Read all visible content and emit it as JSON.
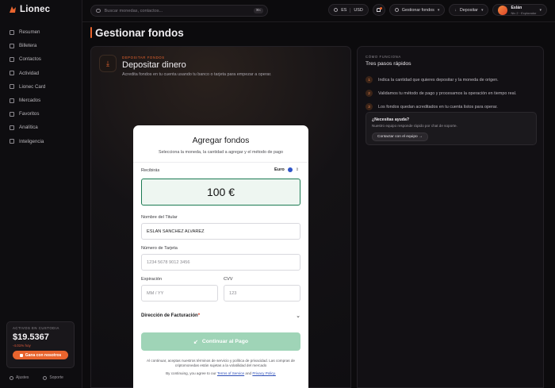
{
  "brand": {
    "name": "Lionec",
    "accent": "#e8642e",
    "success": "#1b7a52"
  },
  "sidebar": {
    "items": [
      {
        "label": "Resumen",
        "icon": "grid-icon"
      },
      {
        "label": "Billetera",
        "icon": "wallet-icon"
      },
      {
        "label": "Contactos",
        "icon": "contacts-icon"
      },
      {
        "label": "Actividad",
        "icon": "activity-icon"
      },
      {
        "label": "Lionec Card",
        "icon": "card-icon"
      },
      {
        "label": "Mercados",
        "icon": "markets-icon"
      },
      {
        "label": "Favoritos",
        "icon": "star-icon"
      },
      {
        "label": "Analítica",
        "icon": "chart-icon"
      },
      {
        "label": "Inteligencia",
        "icon": "brain-icon"
      }
    ],
    "custody": {
      "label": "ACTIVOS EN CUSTODIA",
      "value": "$19.5367",
      "change": "-4.01% hoy",
      "button": "Gana con nosotros"
    },
    "footer": {
      "settings": "Ajustes",
      "support": "Soporte"
    }
  },
  "topbar": {
    "search_placeholder": "Buscar monedas, contactos...",
    "search_shortcut": "⌘K",
    "lang": "ES",
    "currency": "USD",
    "manage_funds": "Gestionar fondos",
    "deposit": "Depositar",
    "user": {
      "name": "Eslán",
      "level": "Niv 2 · Explorador"
    }
  },
  "page": {
    "title": "Gestionar fondos"
  },
  "deposit": {
    "eyebrow": "DEPOSITAR FONDOS",
    "title": "Depositar dinero",
    "subtitle": "Acredita fondos en tu cuenta usando tu banco o tarjeta para empezar a operar."
  },
  "modal": {
    "title": "Agregar fondos",
    "subtitle": "Selecciona la moneda, la cantidad a agregar y el método de pago",
    "receive_label": "Recibirás",
    "currency": "Euro",
    "amount": "100 €",
    "holder_label": "Nombre del Titular",
    "holder_value": "ESLAN SANCHEZ ALVAREZ",
    "card_label": "Número de Tarjeta",
    "card_placeholder": "1234 5678 9012 3456",
    "expiry_label": "Expiración",
    "expiry_placeholder": "MM / YY",
    "cvv_label": "CVV",
    "cvv_placeholder": "123",
    "billing_label": "Dirección de Facturación",
    "billing_required": "*",
    "cta": "Continuar al Pago",
    "legal_es": "Al continuar, aceptas nuestros términos de servicio y política de privacidad. Las compras de criptomonedas están sujetas a la volatilidad del mercado",
    "legal_en_prefix": "By continuing, you agree to our",
    "legal_terms": "Terms of Service",
    "legal_and": "and",
    "legal_privacy": "Privacy Policy."
  },
  "how_it_works": {
    "eyebrow": "CÓMO FUNCIONA",
    "title": "Tres pasos rápidos",
    "steps": [
      {
        "num": "1",
        "text": "Indica la cantidad que quieres depositar y la moneda de origen."
      },
      {
        "num": "2",
        "text": "Validamos tu método de pago y procesamos la operación en tiempo real."
      },
      {
        "num": "3",
        "text": "Los fondos quedan acreditados en tu cuenta listos para operar."
      }
    ],
    "help": {
      "title": "¿Necesitas ayuda?",
      "subtitle": "Nuestro equipo responde rápido por chat de soporte.",
      "button": "Contactar con el equipo →"
    }
  }
}
